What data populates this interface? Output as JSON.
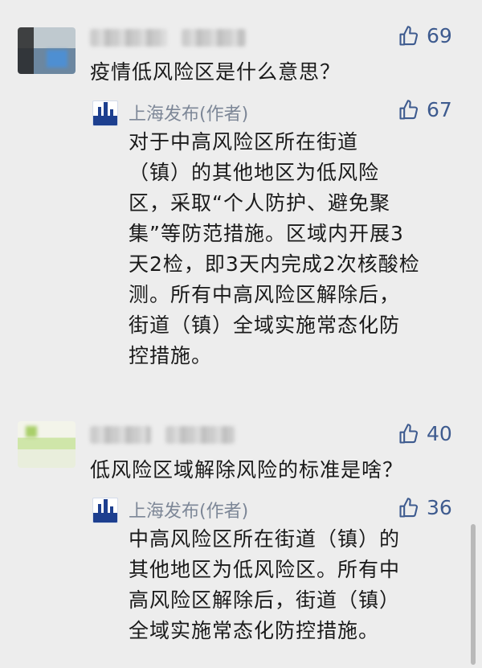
{
  "comments": [
    {
      "likes": "69",
      "question": "疫情低风险区是什么意思？",
      "reply": {
        "author": "上海发布(作者)",
        "likes": "67",
        "lines": [
          "对于中高风险区所在街道",
          "（镇）的其他地区为低风险",
          "区，采取“个人防护、避免聚",
          "集”等防范措施。区域内开展3",
          "天2检，即3天内完成2次核酸检",
          "测。所有中高风险区解除后，",
          "街道（镇）全域实施常态化防",
          "控措施。"
        ]
      }
    },
    {
      "likes": "40",
      "question": "低风险区域解除风险的标准是啥？",
      "reply": {
        "author": "上海发布(作者)",
        "likes": "36",
        "lines": [
          "中高风险区所在街道（镇）的",
          "其他地区为低风险区。所有中",
          "高风险区解除后，街道（镇）",
          "全域实施常态化防控措施。"
        ]
      }
    }
  ],
  "icons": {
    "like": "thumbs-up-icon",
    "logo": "shanghai-fabu-logo"
  },
  "colors": {
    "background": "#ededed",
    "like": "#3e5b8f",
    "author": "#7d8797",
    "logo": "#1d3f8f"
  }
}
